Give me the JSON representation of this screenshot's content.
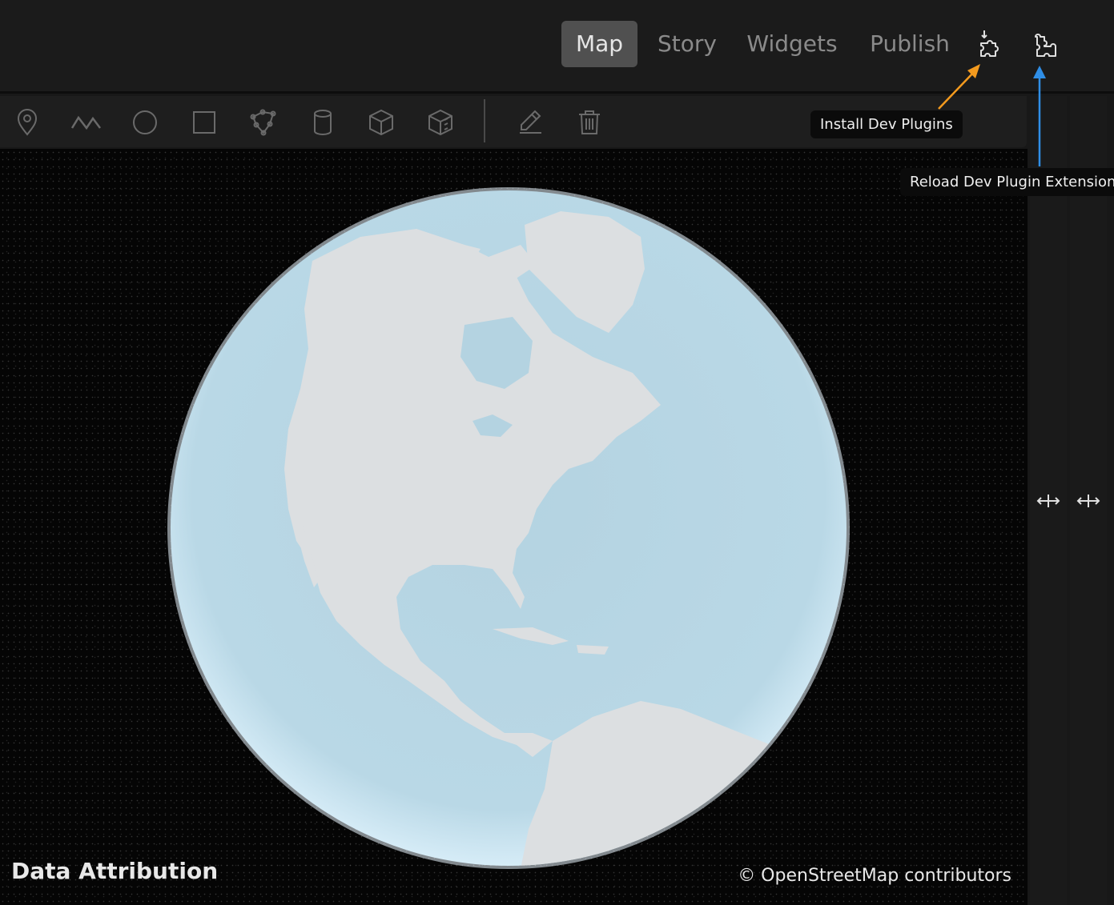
{
  "tabs": [
    {
      "label": "Map",
      "active": true
    },
    {
      "label": "Story",
      "active": false
    },
    {
      "label": "Widgets",
      "active": false
    },
    {
      "label": "Publish",
      "active": false
    }
  ],
  "top_icons": [
    "install-dev-plugins-icon",
    "reload-dev-plugin-extensions-icon"
  ],
  "toolbar_icons": [
    "marker-icon",
    "polyline-icon",
    "circle-icon",
    "rectangle-icon",
    "polygon-icon",
    "cylinder-icon",
    "box-icon",
    "extruded-polygon-icon",
    "edit-icon",
    "delete-icon"
  ],
  "tooltips": {
    "install": "Install Dev Plugins",
    "reload": "Reload Dev Plugin Extensions"
  },
  "annotation_colors": {
    "install_arrow": "#f39a1e",
    "reload_arrow": "#2f8ee6"
  },
  "attribution": {
    "label": "Data Attribution",
    "credit": "© OpenStreetMap contributors"
  }
}
